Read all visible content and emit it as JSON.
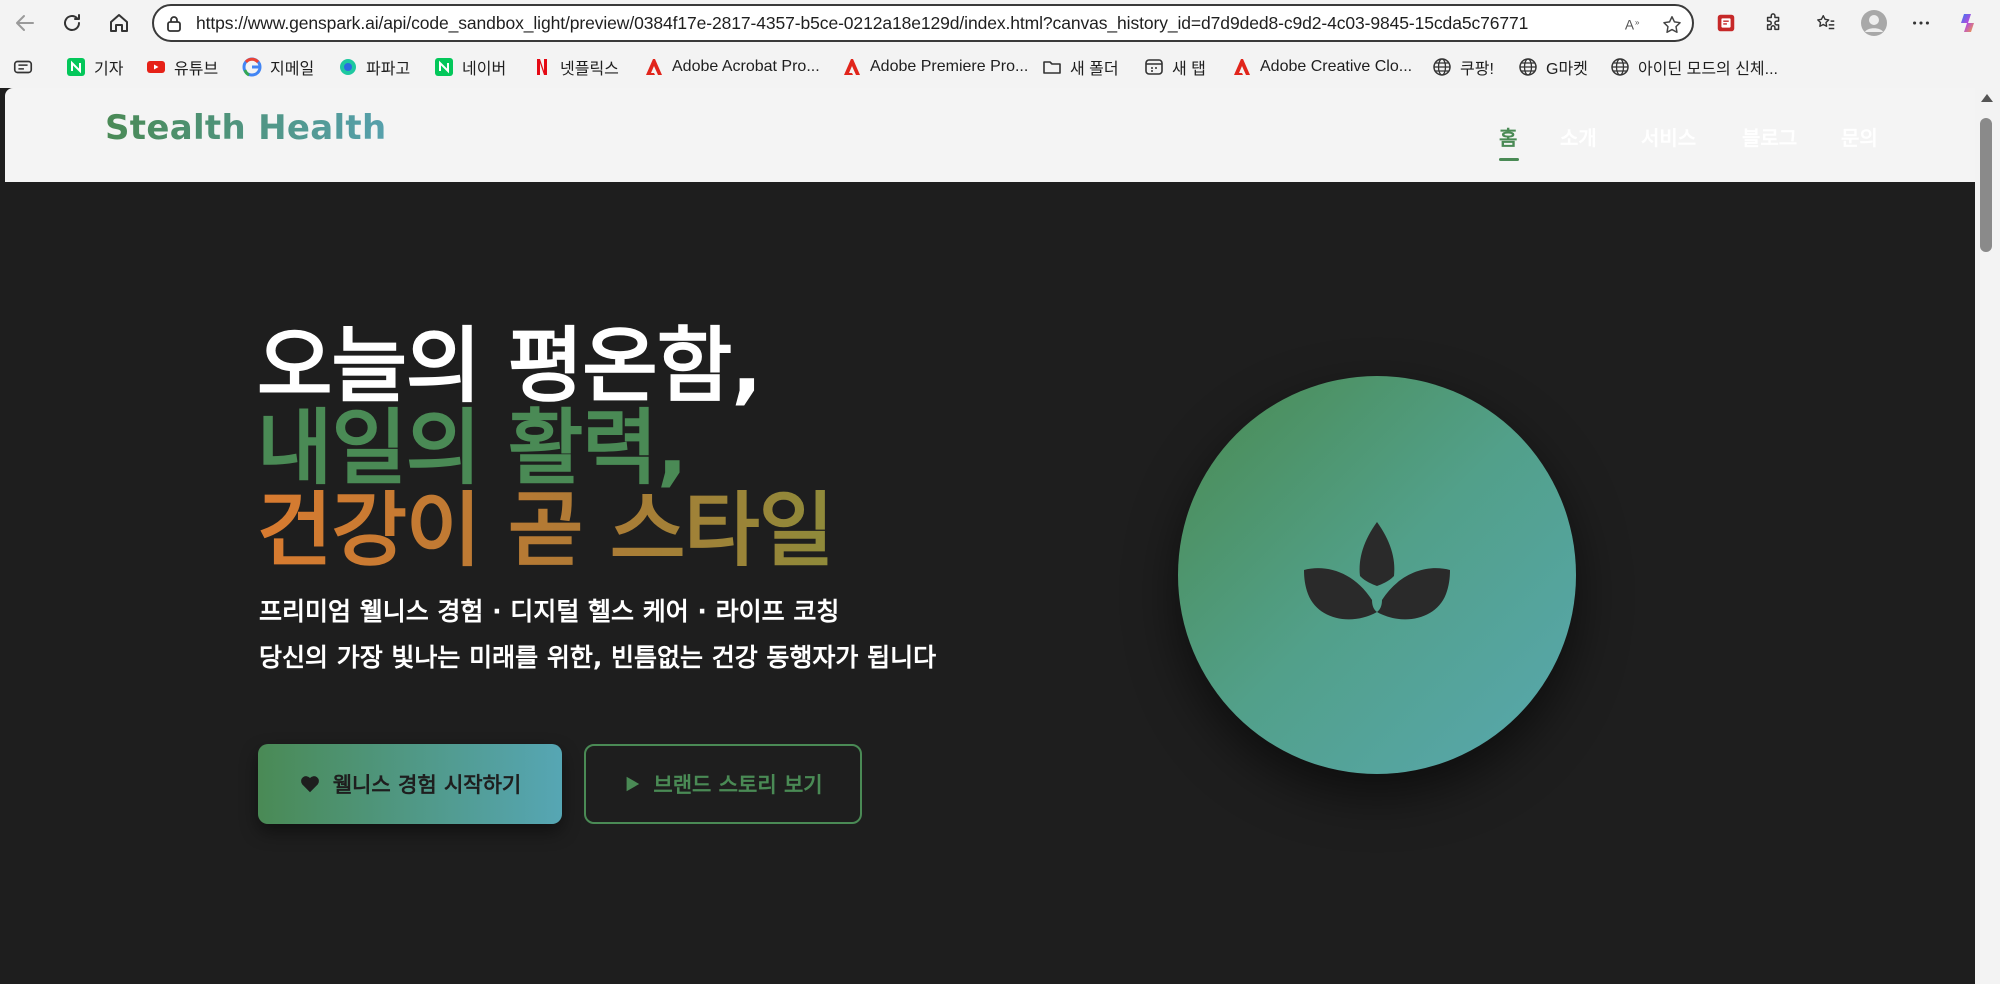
{
  "browser": {
    "url": "https://www.genspark.ai/api/code_sandbox_light/preview/0384f17e-2817-4357-b5ce-0212a18e129d/index.html?canvas_history_id=d7d9ded8-c9d2-4c03-9845-15cda5c76771",
    "toolbar_icons": [
      "back-icon",
      "refresh-icon",
      "home-icon",
      "read-aloud-icon",
      "favorite-star-icon",
      "pdf-extension-icon",
      "extensions-puzzle-icon",
      "favorites-list-icon",
      "profile-icon",
      "more-icon",
      "copilot-icon"
    ],
    "bookmarks": [
      {
        "label": "기자",
        "icon": "naver-icon"
      },
      {
        "label": "유튜브",
        "icon": "youtube-icon"
      },
      {
        "label": "지메일",
        "icon": "google-icon"
      },
      {
        "label": "파파고",
        "icon": "papago-icon"
      },
      {
        "label": "네이버",
        "icon": "naver-icon"
      },
      {
        "label": "넷플릭스",
        "icon": "netflix-icon"
      },
      {
        "label": "Adobe Acrobat Pro...",
        "icon": "adobe-icon"
      },
      {
        "label": "Adobe Premiere Pro...",
        "icon": "adobe-icon"
      },
      {
        "label": "새 폴더",
        "icon": "folder-icon"
      },
      {
        "label": "새 탭",
        "icon": "new-tab-icon"
      },
      {
        "label": "Adobe Creative Clo...",
        "icon": "adobe-icon"
      },
      {
        "label": "쿠팡!",
        "icon": "globe-icon"
      },
      {
        "label": "G마켓",
        "icon": "globe-icon"
      },
      {
        "label": "아이딘 모드의 신체...",
        "icon": "globe-icon"
      }
    ]
  },
  "site": {
    "logo": "Stealth Health",
    "nav": [
      "홈",
      "소개",
      "서비스",
      "블로그",
      "문의"
    ],
    "active_nav": "홈",
    "hero": {
      "line1": "오늘의 평온함,",
      "line2": "내일의 활력,",
      "line3": "건강이 곧 스타일",
      "sub1": "프리미엄 웰니스 경험 · 디지털 헬스 케어 · 라이프 코칭",
      "sub2": "당신의 가장 빛나는 미래를 위한, 빈틈없는 건강 동행자가 됩니다",
      "primary_button": "웰니스 경험 시작하기",
      "secondary_button": "브랜드 스토리 보기",
      "primary_icon": "heart-icon",
      "secondary_icon": "play-icon",
      "emblem_icon": "lotus-icon"
    },
    "colors": {
      "green": "#4a8a55",
      "teal": "#56a6b4",
      "orange": "#d97b30",
      "dark": "#1e1e1e"
    }
  }
}
